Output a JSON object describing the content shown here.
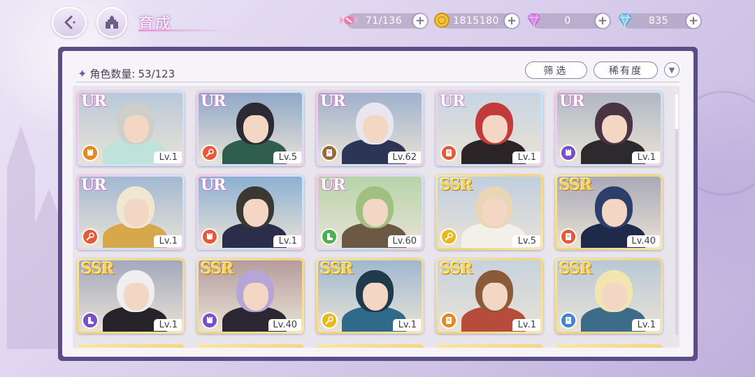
{
  "header": {
    "title": "育成",
    "currencies": [
      {
        "icon": "candy-icon",
        "value": "71/136",
        "color": "#f07aa8"
      },
      {
        "icon": "gold-coin-icon",
        "value": "1815180",
        "color": "#f5c542"
      },
      {
        "icon": "pink-diamond-icon",
        "value": "0",
        "color": "#d884e8"
      },
      {
        "icon": "blue-diamond-icon",
        "value": "835",
        "color": "#7ec8ef"
      }
    ]
  },
  "panel": {
    "count_label": "角色数量:",
    "count_value": "53/123",
    "filter_label": "筛选",
    "sort_label": "稀有度"
  },
  "colors": {
    "panel_border": "#5b4d86",
    "class_red": "#e45a3a",
    "class_orange": "#e8891f",
    "class_purple": "#7b4fc7",
    "class_brown": "#9a6a3a",
    "class_green": "#4caf50",
    "class_yellow": "#e8b91f",
    "class_blue": "#3f86d8"
  },
  "characters": [
    {
      "rarity": "UR",
      "level": "Lv.1",
      "class_color": "#e8891f",
      "class_icon": "fist-icon",
      "hair": "#cfcfc9",
      "outfit": "#bfe3da",
      "bg": "#b8c9d8"
    },
    {
      "rarity": "UR",
      "level": "Lv.5",
      "class_color": "#e45a3a",
      "class_icon": "wand-icon",
      "hair": "#2c2a33",
      "outfit": "#2f5e4e",
      "bg": "#8fa8c9"
    },
    {
      "rarity": "UR",
      "level": "Lv.62",
      "class_color": "#9a6a3a",
      "class_icon": "book-icon",
      "hair": "#e8e6ee",
      "outfit": "#2d3556",
      "bg": "#9fb1cc"
    },
    {
      "rarity": "UR",
      "level": "Lv.1",
      "class_color": "#e45a3a",
      "class_icon": "book-icon",
      "hair": "#c23a3a",
      "outfit": "#2a2429",
      "bg": "#c8d5e2"
    },
    {
      "rarity": "UR",
      "level": "Lv.1",
      "class_color": "#7b4fc7",
      "class_icon": "fist-icon",
      "hair": "#4a3444",
      "outfit": "#2d2a2e",
      "bg": "#b0b8c4"
    },
    {
      "rarity": "UR",
      "level": "Lv.1",
      "class_color": "#e45a3a",
      "class_icon": "wand-icon",
      "hair": "#efe7d2",
      "outfit": "#d6a84b",
      "bg": "#a2b9d2"
    },
    {
      "rarity": "UR",
      "level": "Lv.1",
      "class_color": "#e45a3a",
      "class_icon": "fist-icon",
      "hair": "#3a3830",
      "outfit": "#2a2e4a",
      "bg": "#8cb0d3"
    },
    {
      "rarity": "UR",
      "level": "Lv.60",
      "class_color": "#4caf50",
      "class_icon": "boot-icon",
      "hair": "#9fc07f",
      "outfit": "#6b5845",
      "bg": "#b7d4a9"
    },
    {
      "rarity": "SSR",
      "level": "Lv.5",
      "class_color": "#e8b91f",
      "class_icon": "wand-icon",
      "hair": "#e8d6b6",
      "outfit": "#f3f0ea",
      "bg": "#bfcfe0"
    },
    {
      "rarity": "SSR",
      "level": "Lv.40",
      "class_color": "#e45a3a",
      "class_icon": "book-icon",
      "hair": "#2c3e6a",
      "outfit": "#1f2a4a",
      "bg": "#a9a9b8"
    },
    {
      "rarity": "SSR",
      "level": "Lv.1",
      "class_color": "#7b4fc7",
      "class_icon": "boot-icon",
      "hair": "#efeff2",
      "outfit": "#26232b",
      "bg": "#a4a8bd"
    },
    {
      "rarity": "SSR",
      "level": "Lv.40",
      "class_color": "#7b4fc7",
      "class_icon": "fist-icon",
      "hair": "#b6a6d8",
      "outfit": "#2b2833",
      "bg": "#b59c9c"
    },
    {
      "rarity": "SSR",
      "level": "Lv.1",
      "class_color": "#e8b91f",
      "class_icon": "wand-icon",
      "hair": "#1f3a4a",
      "outfit": "#2f6a8a",
      "bg": "#9fb8d0"
    },
    {
      "rarity": "SSR",
      "level": "Lv.1",
      "class_color": "#e8891f",
      "class_icon": "book-icon",
      "hair": "#8a5a3a",
      "outfit": "#b84c3c",
      "bg": "#c7d2dd"
    },
    {
      "rarity": "SSR",
      "level": "Lv.1",
      "class_color": "#3f86d8",
      "class_icon": "book-icon",
      "hair": "#f2e6b0",
      "outfit": "#3d6b8a",
      "bg": "#b9c8d6"
    }
  ]
}
